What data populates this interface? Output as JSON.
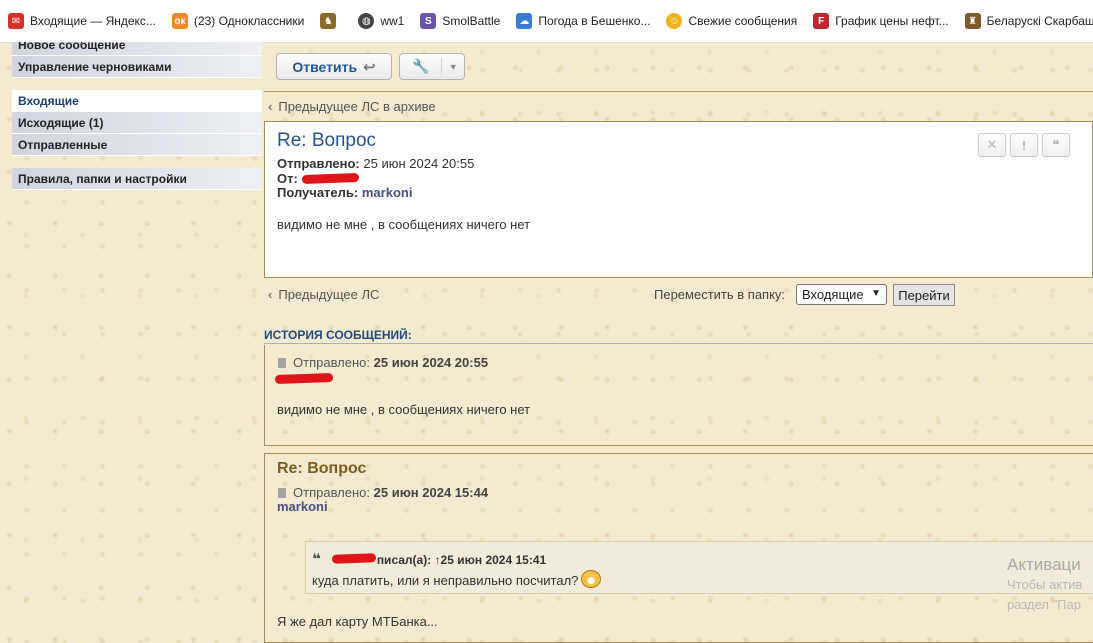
{
  "bookmarks": [
    {
      "label": "Входящие — Яндекс...",
      "icon": "mail-icon",
      "color": "#d7322a"
    },
    {
      "label": "(23) Одноклассники",
      "icon": "odnoklassniki-icon",
      "color": "#f08a24"
    },
    {
      "label": "",
      "icon": "game-icon",
      "color": "#8a6a2a"
    },
    {
      "label": "ww1",
      "icon": "globe-icon",
      "color": "#444444"
    },
    {
      "label": "SmolBattle",
      "icon": "smolbattle-icon",
      "color": "#6a55a8"
    },
    {
      "label": "Погода в Бешенко...",
      "icon": "weather-icon",
      "color": "#3a7bd5"
    },
    {
      "label": "Свежие сообщения",
      "icon": "forum-icon",
      "color": "#f2b21a"
    },
    {
      "label": "График цены нефт...",
      "icon": "chart-icon",
      "color": "#c0262d"
    },
    {
      "label": "Беларускі Скарбаш...",
      "icon": "treasure-icon",
      "color": "#7a5a2e"
    }
  ],
  "sidebar": {
    "items": [
      {
        "label": "Новое сообщение"
      },
      {
        "label": "Управление черновиками"
      },
      {
        "label": "Входящие"
      },
      {
        "label": "Исходящие (1)"
      },
      {
        "label": "Отправленные"
      },
      {
        "label": "Правила, папки и настройки"
      }
    ]
  },
  "toolbar": {
    "reply_label": "Ответить",
    "reply_icon": "reply-arrow-icon",
    "tools_icon": "wrench-icon"
  },
  "nav": {
    "prev_archive": "Предыдущее ЛС в архиве",
    "prev": "Предыдущее ЛС"
  },
  "message": {
    "title": "Re: Вопрос",
    "sent_label": "Отправлено:",
    "sent_value": "25 июн 2024 20:55",
    "from_label": "От:",
    "to_label": "Получатель:",
    "to_value": "markoni",
    "body": "видимо не мне , в сообщениях ничего нет",
    "action_icons": [
      "delete-icon",
      "report-icon",
      "quote-icon"
    ]
  },
  "move": {
    "label": "Переместить в папку:",
    "selected": "Входящие",
    "go_label": "Перейти"
  },
  "history": {
    "title": "ИСТОРИЯ СООБЩЕНИЙ:",
    "posts": [
      {
        "title": "",
        "sent_label": "Отправлено:",
        "sent_value": "25 июн 2024 20:55",
        "author": "",
        "body": "видимо не мне , в сообщениях ничего нет"
      },
      {
        "title": "Re: Вопрос",
        "sent_label": "Отправлено:",
        "sent_value": "25 июн 2024 15:44",
        "author": "markoni",
        "quote": {
          "meta": "писал(а): ↑25 июн 2024 15:41",
          "text": "куда платить, или я неправильно посчитал?"
        },
        "body": "Я же дал карту МТБанка..."
      }
    ]
  },
  "watermark": {
    "line1": "Активаци",
    "line2": "Чтобы актив",
    "line3": "раздел \"Пар"
  }
}
